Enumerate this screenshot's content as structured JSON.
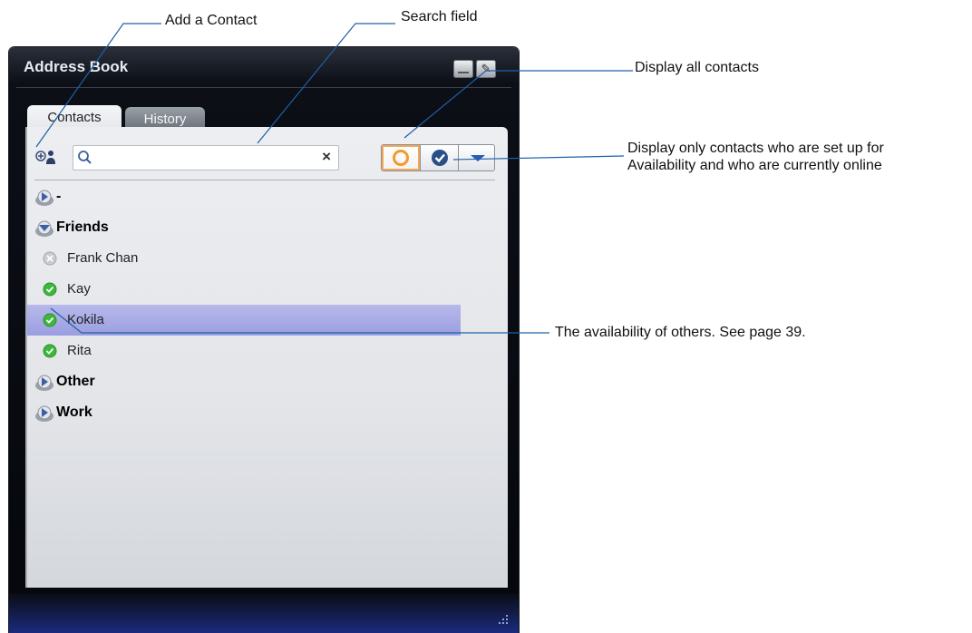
{
  "callouts": {
    "add_contact": "Add a Contact",
    "search_field": "Search field",
    "display_all": "Display all contacts",
    "display_online_line1": "Display only contacts who are set up for",
    "display_online_line2": "Availability and who are currently online",
    "availability": "The availability of others. See page 39."
  },
  "window": {
    "title": "Address Book",
    "edit_glyph": "✎"
  },
  "tabs": [
    {
      "label": "Contacts",
      "active": true
    },
    {
      "label": "History",
      "active": false
    }
  ],
  "search": {
    "value": "",
    "placeholder": "",
    "clear_glyph": "×"
  },
  "filters": {
    "all_icon": "orange-ring-icon",
    "online_icon": "blue-check-icon",
    "menu_icon": "dropdown-triangle-icon"
  },
  "groups": {
    "ungrouped": {
      "label": "-",
      "icon": "group-expand-icon"
    },
    "friends": {
      "label": "Friends",
      "icon": "group-collapse-icon"
    },
    "other": {
      "label": "Other",
      "icon": "group-expand-icon"
    },
    "work": {
      "label": "Work",
      "icon": "group-expand-icon"
    }
  },
  "contacts": [
    {
      "name": "Frank Chan",
      "status": "offline"
    },
    {
      "name": "Kay",
      "status": "online"
    },
    {
      "name": "Kokila",
      "status": "online",
      "selected": true
    },
    {
      "name": "Rita",
      "status": "online"
    }
  ],
  "colors": {
    "online": "#3cb83c",
    "offline": "#b9bcc1",
    "selection": "#a7aae4",
    "accent_ring": "#f29a2e",
    "check_blue": "#2a4f86"
  }
}
